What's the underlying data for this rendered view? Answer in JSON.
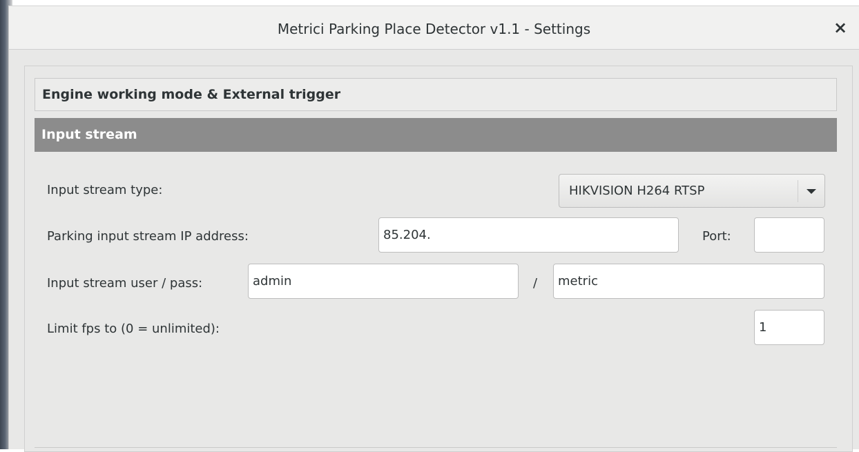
{
  "window": {
    "title": "Metrici Parking Place Detector v1.1 - Settings",
    "close_label": "×"
  },
  "sections": {
    "engine": "Engine working mode & External trigger",
    "input_stream": "Input stream"
  },
  "form": {
    "stream_type_label": "Input stream type:",
    "stream_type_value": "HIKVISION H264 RTSP",
    "ip_label": "Parking input stream IP address:",
    "ip_value": "85.204.",
    "port_label": "Port:",
    "port_value": "",
    "user_pass_label": "Input stream user / pass:",
    "user_value": "admin",
    "slash": "/",
    "pass_value": "metric",
    "fps_label": "Limit fps to (0 = unlimited):",
    "fps_value": "1"
  },
  "icons": {
    "close": "close-icon",
    "dropdown": "chevron-down-icon"
  }
}
